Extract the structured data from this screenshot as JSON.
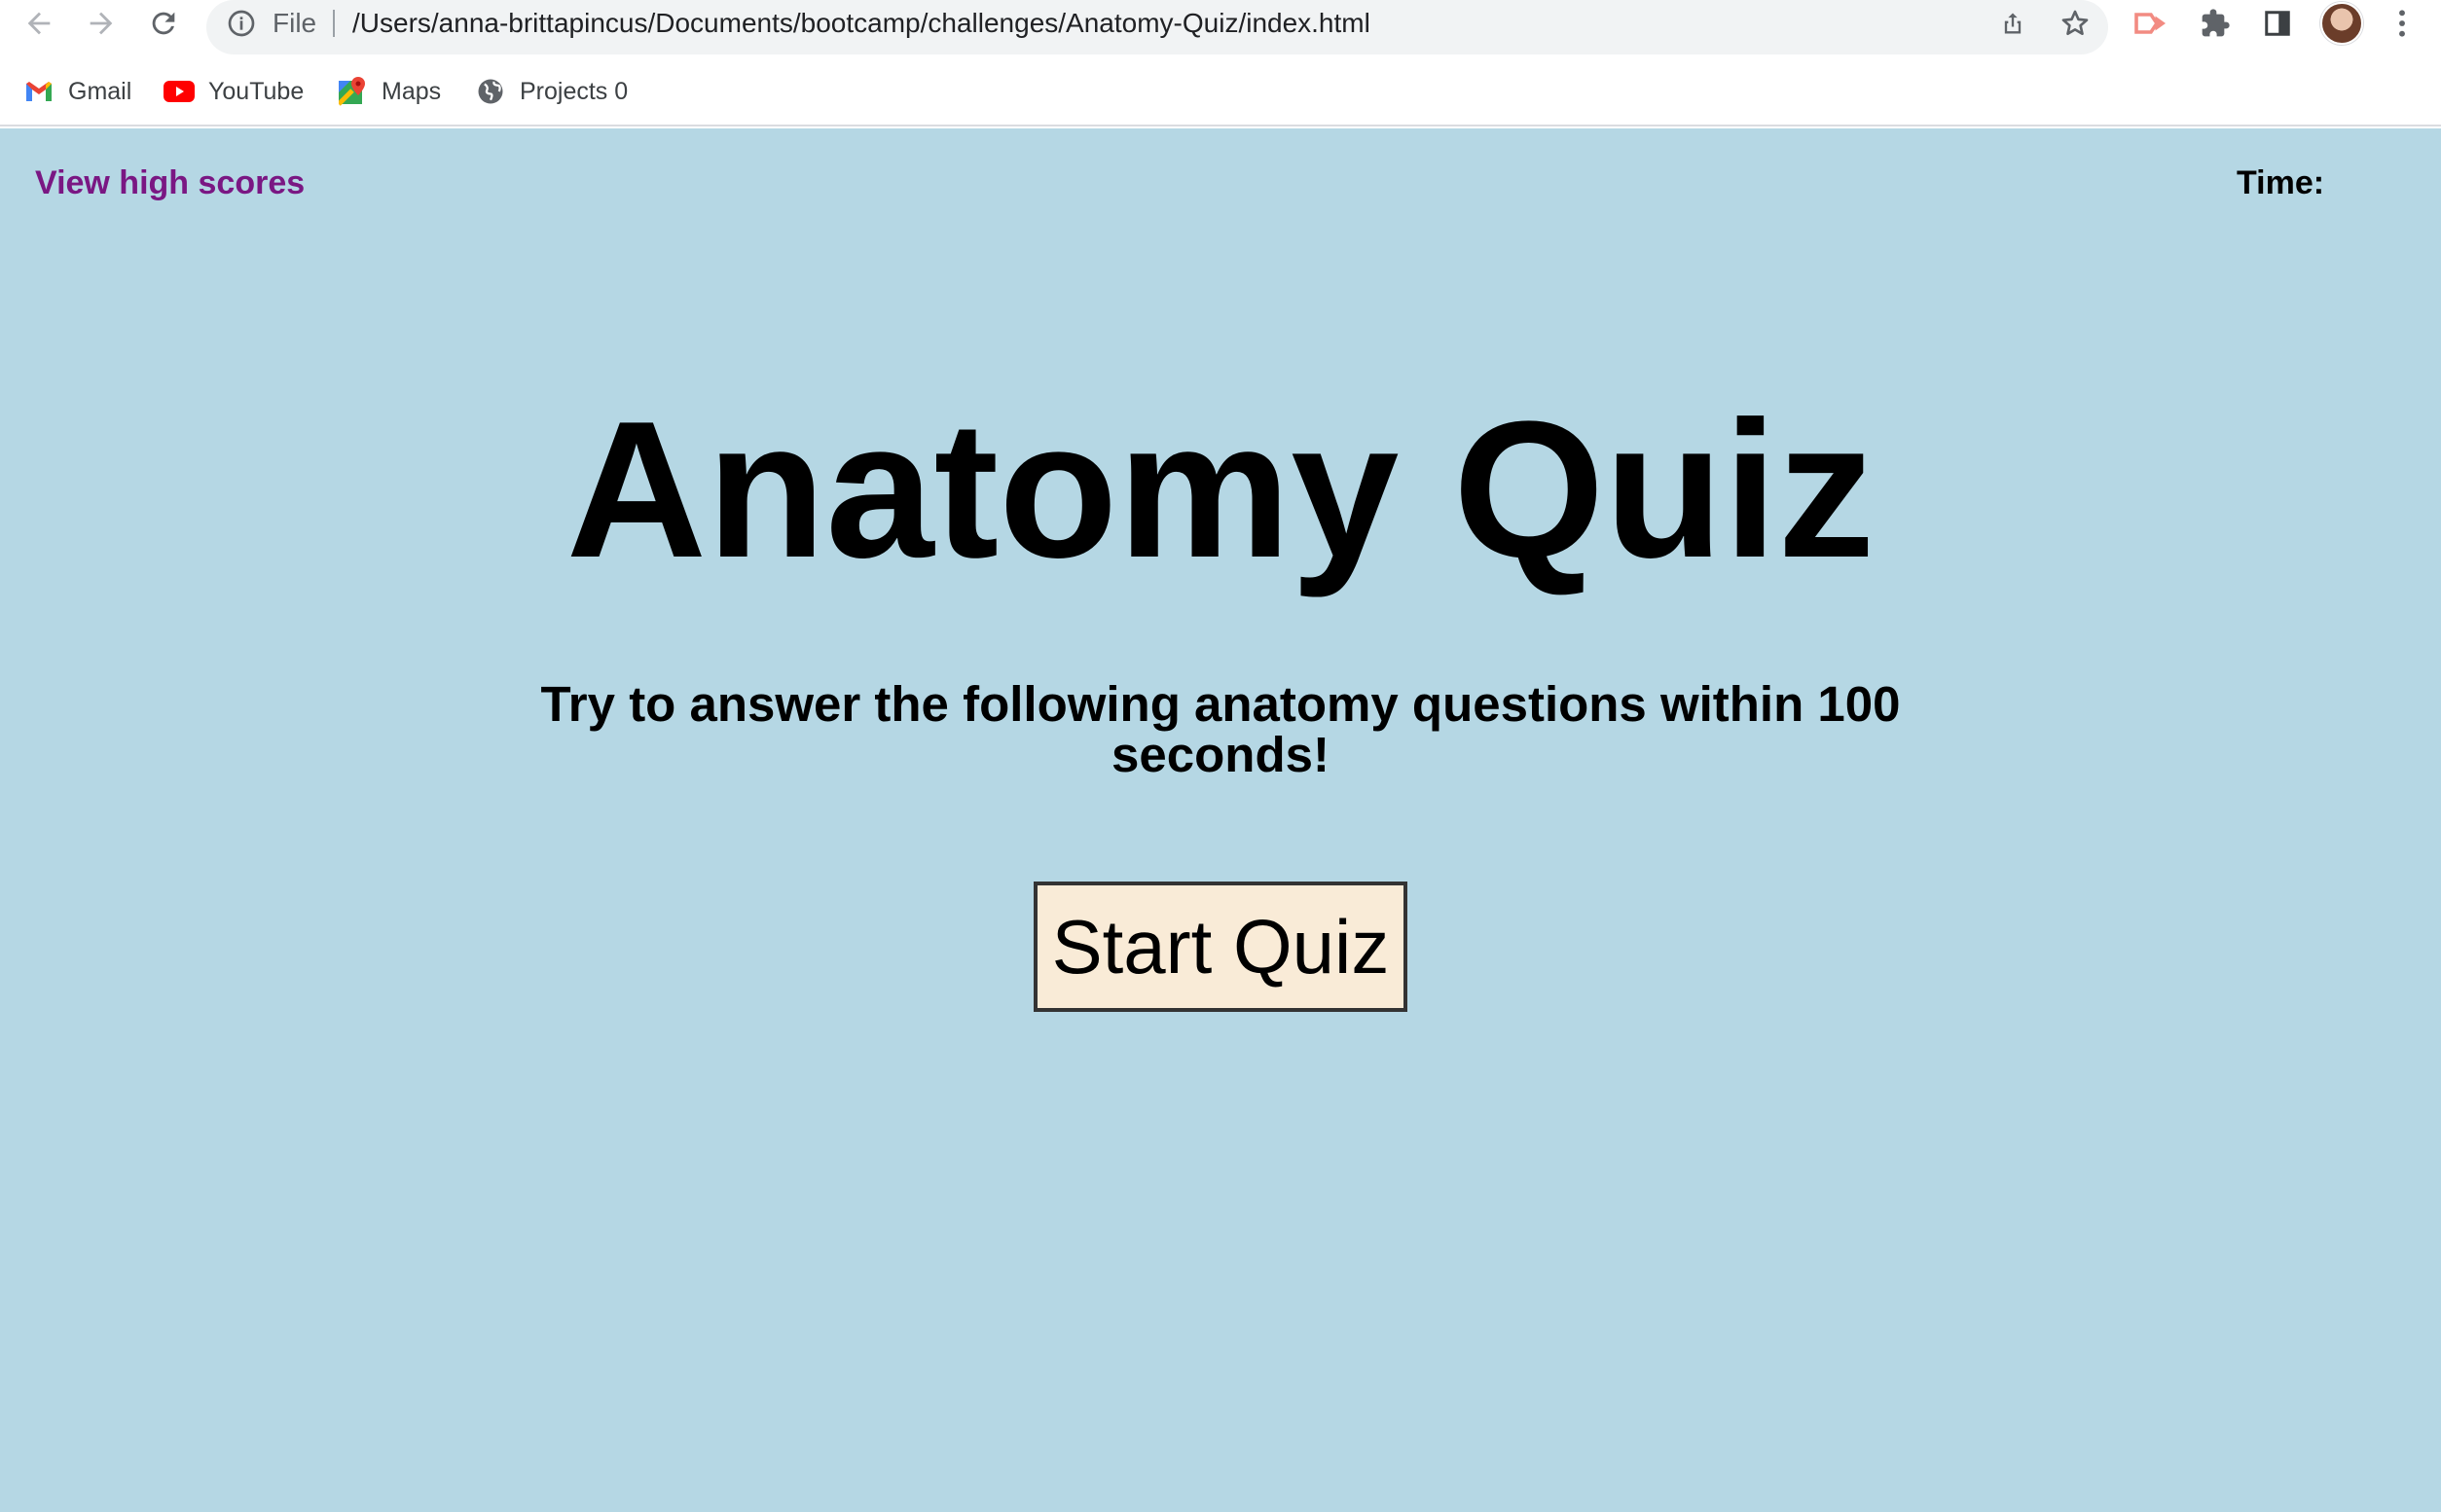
{
  "browser": {
    "omnibox": {
      "scheme_label": "File",
      "url": "/Users/anna-brittapincus/Documents/bootcamp/challenges/Anatomy-Quiz/index.html"
    },
    "bookmarks": [
      {
        "label": "Gmail",
        "icon": "gmail-icon"
      },
      {
        "label": "YouTube",
        "icon": "youtube-icon"
      },
      {
        "label": "Maps",
        "icon": "maps-icon"
      },
      {
        "label": "Projects 0",
        "icon": "globe-icon"
      }
    ]
  },
  "page": {
    "high_scores_link": "View high scores",
    "timer_label": "Time:",
    "title": "Anatomy Quiz",
    "subtitle": "Try to answer the following anatomy questions within 100 seconds!",
    "start_button": "Start Quiz"
  },
  "colors": {
    "page_background": "#b5d7e4",
    "link": "#7a1783",
    "button_background": "#f9ebd7"
  }
}
